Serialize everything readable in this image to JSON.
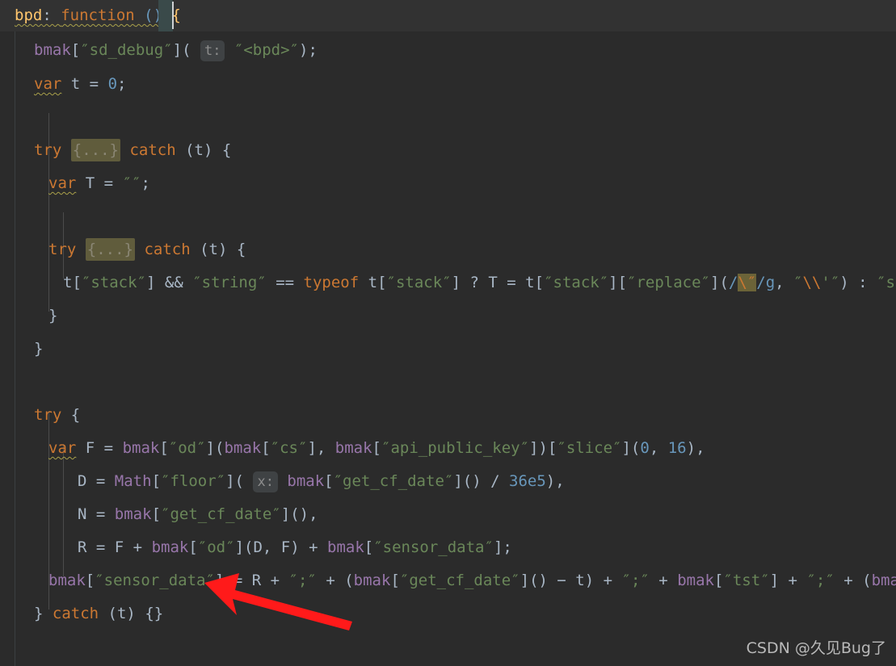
{
  "editor": {
    "theme_name": "darcula",
    "background": "#2b2b2b",
    "header_background": "#323232",
    "gutter_background": "#2b2b2b",
    "caret_color": "#cfd2d4",
    "fold_background": "#605c3c",
    "hint_background": "#3f4244",
    "highlight_background": "#6b6338",
    "annotation_color": "#ff1a1a"
  },
  "sticky_header": {
    "name": "bpd",
    "colon": ": ",
    "keyword": "function",
    "parens": " ()",
    "space": " ",
    "brace": "{"
  },
  "hints": {
    "t_label": "t:",
    "x_label": "x:"
  },
  "code_lines": [
    {
      "id": "line-bmak-sd-debug",
      "tokens": [
        {
          "t": "bmak",
          "c": "prop"
        },
        {
          "t": "[",
          "c": "punct"
        },
        {
          "t": "″sd_debug″",
          "c": "str"
        },
        {
          "t": "]",
          "c": "punct"
        },
        {
          "t": "(",
          "c": "punct"
        },
        {
          "t": " ",
          "c": "punct"
        },
        {
          "t": "t:",
          "c": "hint"
        },
        {
          "t": " ",
          "c": "punct"
        },
        {
          "t": "″<bpd>″",
          "c": "str"
        },
        {
          "t": ")",
          "c": "punct"
        },
        {
          "t": ";",
          "c": "punct"
        }
      ]
    },
    {
      "id": "line-var-t",
      "tokens": [
        {
          "t": "var",
          "c": "kw wavy"
        },
        {
          "t": " t ",
          "c": "ident"
        },
        {
          "t": "=",
          "c": "op"
        },
        {
          "t": " ",
          "c": "ident"
        },
        {
          "t": "0",
          "c": "num"
        },
        {
          "t": ";",
          "c": "punct"
        }
      ]
    },
    {
      "id": "line-try-catch-outer",
      "tokens": [
        {
          "t": "try",
          "c": "kw"
        },
        {
          "t": " ",
          "c": "ident"
        },
        {
          "t": "{...}",
          "c": "fold"
        },
        {
          "t": " ",
          "c": "ident"
        },
        {
          "t": "catch",
          "c": "kw"
        },
        {
          "t": " (t) ",
          "c": "ident"
        },
        {
          "t": "{",
          "c": "brace"
        }
      ]
    },
    {
      "id": "line-var-T",
      "tokens": [
        {
          "t": "var",
          "c": "kw wavy"
        },
        {
          "t": " T ",
          "c": "ident"
        },
        {
          "t": "=",
          "c": "op"
        },
        {
          "t": " ",
          "c": "ident"
        },
        {
          "t": "″″",
          "c": "str"
        },
        {
          "t": ";",
          "c": "punct"
        }
      ]
    },
    {
      "id": "line-try-catch-inner",
      "tokens": [
        {
          "t": "try",
          "c": "kw"
        },
        {
          "t": " ",
          "c": "ident"
        },
        {
          "t": "{...}",
          "c": "fold"
        },
        {
          "t": " ",
          "c": "ident"
        },
        {
          "t": "catch",
          "c": "kw"
        },
        {
          "t": " (t) ",
          "c": "ident"
        },
        {
          "t": "{",
          "c": "brace"
        }
      ]
    },
    {
      "id": "line-stack-ternary",
      "tokens": [
        {
          "t": "t",
          "c": "ident"
        },
        {
          "t": "[",
          "c": "punct"
        },
        {
          "t": "″stack″",
          "c": "str"
        },
        {
          "t": "]",
          "c": "punct"
        },
        {
          "t": " ",
          "c": "ident"
        },
        {
          "t": "&&",
          "c": "op"
        },
        {
          "t": " ",
          "c": "ident"
        },
        {
          "t": "″string″",
          "c": "str"
        },
        {
          "t": " ",
          "c": "ident"
        },
        {
          "t": "==",
          "c": "op"
        },
        {
          "t": " ",
          "c": "ident"
        },
        {
          "t": "typeof",
          "c": "kw"
        },
        {
          "t": " t",
          "c": "ident"
        },
        {
          "t": "[",
          "c": "punct"
        },
        {
          "t": "″stack″",
          "c": "str"
        },
        {
          "t": "]",
          "c": "punct"
        },
        {
          "t": " ? T ",
          "c": "ident"
        },
        {
          "t": "=",
          "c": "op"
        },
        {
          "t": " t",
          "c": "ident"
        },
        {
          "t": "[",
          "c": "punct"
        },
        {
          "t": "″stack″",
          "c": "str"
        },
        {
          "t": "]",
          "c": "punct"
        },
        {
          "t": "[",
          "c": "punct"
        },
        {
          "t": "″replace″",
          "c": "str"
        },
        {
          "t": "]",
          "c": "punct"
        },
        {
          "t": "(",
          "c": "punct"
        },
        {
          "t": "/",
          "c": "num"
        },
        {
          "t": "\\″",
          "c": "hl-token esc"
        },
        {
          "t": "/g",
          "c": "num"
        },
        {
          "t": ", ",
          "c": "punct"
        },
        {
          "t": "″",
          "c": "str"
        },
        {
          "t": "\\\\",
          "c": "esc"
        },
        {
          "t": "'″",
          "c": "str"
        },
        {
          "t": ")",
          "c": "punct"
        },
        {
          "t": " : ",
          "c": "ident"
        },
        {
          "t": "″stri",
          "c": "str"
        }
      ]
    },
    {
      "id": "line-close-inner",
      "tokens": [
        {
          "t": "}",
          "c": "brace"
        }
      ]
    },
    {
      "id": "line-close-outer",
      "tokens": [
        {
          "t": "}",
          "c": "brace"
        }
      ]
    },
    {
      "id": "line-try-open",
      "tokens": [
        {
          "t": "try",
          "c": "kw"
        },
        {
          "t": " ",
          "c": "ident"
        },
        {
          "t": "{",
          "c": "brace"
        }
      ]
    },
    {
      "id": "line-var-F",
      "tokens": [
        {
          "t": "var",
          "c": "kw wavy"
        },
        {
          "t": " F ",
          "c": "ident"
        },
        {
          "t": "=",
          "c": "op"
        },
        {
          "t": " ",
          "c": "ident"
        },
        {
          "t": "bmak",
          "c": "prop"
        },
        {
          "t": "[",
          "c": "punct"
        },
        {
          "t": "″od″",
          "c": "str"
        },
        {
          "t": "]",
          "c": "punct"
        },
        {
          "t": "(",
          "c": "punct"
        },
        {
          "t": "bmak",
          "c": "prop"
        },
        {
          "t": "[",
          "c": "punct"
        },
        {
          "t": "″cs″",
          "c": "str"
        },
        {
          "t": "]",
          "c": "punct"
        },
        {
          "t": ", ",
          "c": "punct"
        },
        {
          "t": "bmak",
          "c": "prop"
        },
        {
          "t": "[",
          "c": "punct"
        },
        {
          "t": "″api_public_key″",
          "c": "str"
        },
        {
          "t": "]",
          "c": "punct"
        },
        {
          "t": ")",
          "c": "punct"
        },
        {
          "t": "[",
          "c": "punct"
        },
        {
          "t": "″slice″",
          "c": "str"
        },
        {
          "t": "]",
          "c": "punct"
        },
        {
          "t": "(",
          "c": "punct"
        },
        {
          "t": "0",
          "c": "num"
        },
        {
          "t": ", ",
          "c": "punct"
        },
        {
          "t": "16",
          "c": "num"
        },
        {
          "t": ")",
          "c": "punct"
        },
        {
          "t": ",",
          "c": "punct"
        }
      ]
    },
    {
      "id": "line-D-math-floor",
      "tokens": [
        {
          "t": "D ",
          "c": "ident"
        },
        {
          "t": "=",
          "c": "op"
        },
        {
          "t": " ",
          "c": "ident"
        },
        {
          "t": "Math",
          "c": "prop"
        },
        {
          "t": "[",
          "c": "punct"
        },
        {
          "t": "″floor″",
          "c": "str"
        },
        {
          "t": "]",
          "c": "punct"
        },
        {
          "t": "(",
          "c": "punct"
        },
        {
          "t": " ",
          "c": "punct"
        },
        {
          "t": "x:",
          "c": "hint"
        },
        {
          "t": " ",
          "c": "punct"
        },
        {
          "t": "bmak",
          "c": "prop"
        },
        {
          "t": "[",
          "c": "punct"
        },
        {
          "t": "″get_cf_date″",
          "c": "str"
        },
        {
          "t": "]",
          "c": "punct"
        },
        {
          "t": "() ",
          "c": "punct"
        },
        {
          "t": "/",
          "c": "op"
        },
        {
          "t": " ",
          "c": "ident"
        },
        {
          "t": "36e5",
          "c": "num"
        },
        {
          "t": "),",
          "c": "punct"
        }
      ]
    },
    {
      "id": "line-N-get-cf-date",
      "tokens": [
        {
          "t": "N ",
          "c": "ident"
        },
        {
          "t": "=",
          "c": "op"
        },
        {
          "t": " ",
          "c": "ident"
        },
        {
          "t": "bmak",
          "c": "prop"
        },
        {
          "t": "[",
          "c": "punct"
        },
        {
          "t": "″get_cf_date″",
          "c": "str"
        },
        {
          "t": "]",
          "c": "punct"
        },
        {
          "t": "(),",
          "c": "punct"
        }
      ]
    },
    {
      "id": "line-R-concat",
      "tokens": [
        {
          "t": "R ",
          "c": "ident"
        },
        {
          "t": "=",
          "c": "op"
        },
        {
          "t": " F ",
          "c": "ident"
        },
        {
          "t": "+",
          "c": "op"
        },
        {
          "t": " ",
          "c": "ident"
        },
        {
          "t": "bmak",
          "c": "prop"
        },
        {
          "t": "[",
          "c": "punct"
        },
        {
          "t": "″od″",
          "c": "str"
        },
        {
          "t": "]",
          "c": "punct"
        },
        {
          "t": "(D, F) ",
          "c": "punct"
        },
        {
          "t": "+",
          "c": "op"
        },
        {
          "t": " ",
          "c": "ident"
        },
        {
          "t": "bmak",
          "c": "prop"
        },
        {
          "t": "[",
          "c": "punct"
        },
        {
          "t": "″sensor_data″",
          "c": "str"
        },
        {
          "t": "]",
          "c": "punct"
        },
        {
          "t": ";",
          "c": "punct"
        }
      ]
    },
    {
      "id": "line-sensor-data-assign",
      "tokens": [
        {
          "t": "bmak",
          "c": "prop"
        },
        {
          "t": "[",
          "c": "punct"
        },
        {
          "t": "″sensor_data″",
          "c": "str"
        },
        {
          "t": "]",
          "c": "punct"
        },
        {
          "t": " ",
          "c": "ident"
        },
        {
          "t": "=",
          "c": "op"
        },
        {
          "t": " R ",
          "c": "ident"
        },
        {
          "t": "+",
          "c": "op"
        },
        {
          "t": " ",
          "c": "ident"
        },
        {
          "t": "″;″",
          "c": "str"
        },
        {
          "t": " ",
          "c": "ident"
        },
        {
          "t": "+",
          "c": "op"
        },
        {
          "t": " ",
          "c": "ident"
        },
        {
          "t": "(",
          "c": "punct"
        },
        {
          "t": "bmak",
          "c": "prop"
        },
        {
          "t": "[",
          "c": "punct"
        },
        {
          "t": "″get_cf_date″",
          "c": "str"
        },
        {
          "t": "]",
          "c": "punct"
        },
        {
          "t": "() ",
          "c": "punct"
        },
        {
          "t": "−",
          "c": "op"
        },
        {
          "t": " t) ",
          "c": "ident"
        },
        {
          "t": "+",
          "c": "op"
        },
        {
          "t": " ",
          "c": "ident"
        },
        {
          "t": "″;″",
          "c": "str"
        },
        {
          "t": " ",
          "c": "ident"
        },
        {
          "t": "+",
          "c": "op"
        },
        {
          "t": " ",
          "c": "ident"
        },
        {
          "t": "bmak",
          "c": "prop"
        },
        {
          "t": "[",
          "c": "punct"
        },
        {
          "t": "″tst″",
          "c": "str"
        },
        {
          "t": "]",
          "c": "punct"
        },
        {
          "t": " ",
          "c": "ident"
        },
        {
          "t": "+",
          "c": "op"
        },
        {
          "t": " ",
          "c": "ident"
        },
        {
          "t": "″;″",
          "c": "str"
        },
        {
          "t": " ",
          "c": "ident"
        },
        {
          "t": "+",
          "c": "op"
        },
        {
          "t": " ",
          "c": "ident"
        },
        {
          "t": "(",
          "c": "punct"
        },
        {
          "t": "bmak",
          "c": "prop"
        },
        {
          "t": "[",
          "c": "punct"
        },
        {
          "t": "″",
          "c": "str"
        }
      ]
    },
    {
      "id": "line-catch-empty",
      "tokens": [
        {
          "t": "}",
          "c": "brace"
        },
        {
          "t": " ",
          "c": "ident"
        },
        {
          "t": "catch",
          "c": "kw"
        },
        {
          "t": " (t) ",
          "c": "ident"
        },
        {
          "t": "{}",
          "c": "brace"
        }
      ]
    }
  ],
  "annotation": {
    "type": "red-arrow",
    "color": "#ff1a1a",
    "points_at": "bmak[″sensor_data″]"
  },
  "watermark": {
    "text": "CSDN @久见Bug了"
  }
}
